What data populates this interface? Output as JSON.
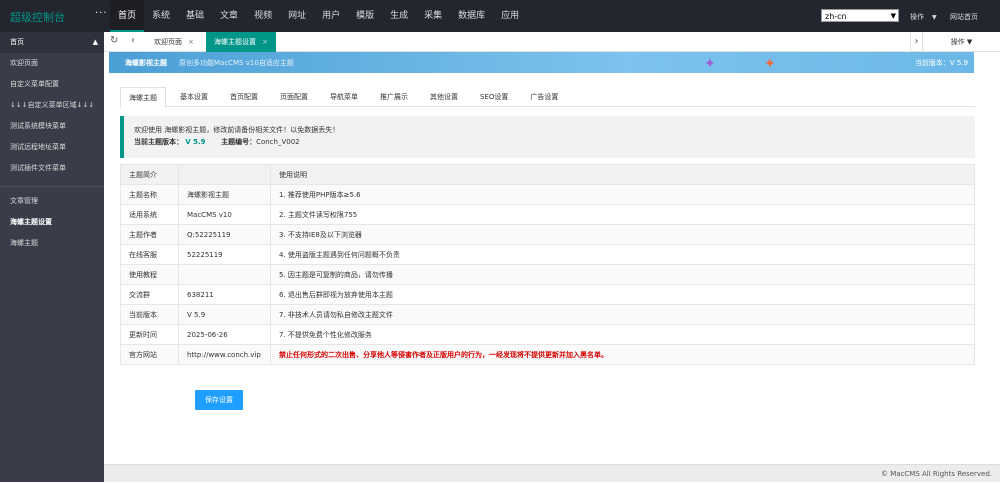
{
  "topbar": {
    "logo": "超级控制台",
    "nav": [
      "首页",
      "系统",
      "基础",
      "文章",
      "视频",
      "网址",
      "用户",
      "模版",
      "生成",
      "采集",
      "数据库",
      "应用"
    ],
    "lang": "zh-cn",
    "operate": "操作",
    "site_home": "网站首页"
  },
  "sidebar": {
    "head": "首页",
    "group1": [
      "欢迎页面",
      "自定义菜单配置",
      "↓↓↓自定义菜单区域↓↓↓",
      "测试系统模块菜单",
      "测试远程地址菜单",
      "测试插件文件菜单"
    ],
    "group2": [
      "文章管理",
      "海螺主题设置",
      "海螺主题"
    ]
  },
  "tabs": {
    "welcome": "欢迎页面",
    "theme": "海螺主题设置",
    "operate": "操作"
  },
  "banner": {
    "title": "海螺影视主题",
    "subtitle": "原创多功能MacCMS v10自适应主题",
    "version": "当前版本：V 5.9"
  },
  "content_tabs": [
    "海螺主题",
    "基本设置",
    "首页配置",
    "页面配置",
    "导航菜单",
    "推广展示",
    "其他设置",
    "SEO设置",
    "广告设置"
  ],
  "notice": {
    "line1": "欢迎使用 海螺影视主题，修改前请备份相关文件！以免数据丢失！",
    "version_label": "当前主题版本：",
    "version_value": "V 5.9",
    "id_label": "主题编号：",
    "id_value": "Conch_V002"
  },
  "table": {
    "header": [
      "主题简介",
      "",
      "使用说明"
    ],
    "rows": [
      [
        "主题名称",
        "海螺影视主题",
        "1. 推荐使用PHP版本≥5.6"
      ],
      [
        "适用系统",
        "MacCMS v10",
        "2. 主题文件读写权限755"
      ],
      [
        "主题作者",
        "Q:52225119",
        "3. 不支持IE8及以下浏览器"
      ],
      [
        "在线客服",
        "52225119",
        "4. 使用盗版主题遇到任何问题概不负责"
      ],
      [
        "使用教程",
        "",
        "5. 因主题是可复制的商品，请勿传播"
      ],
      [
        "交流群",
        "638211",
        "6. 退出售后群即视为放弃使用本主题"
      ],
      [
        "当前版本",
        "V 5.9",
        "7. 非技术人员请勿私自修改主题文件"
      ],
      [
        "更新时间",
        "2025-06-26",
        "7. 不提供免费个性化修改服务"
      ],
      [
        "官方网站",
        "http://www.conch.vip",
        "禁止任何形式的二次出售、分享他人等侵害作者及正版用户的行为，一经发现将不提供更新并加入黑名单。"
      ]
    ]
  },
  "save_label": "保存设置",
  "footer": "© MacCMS All Rights Reserved."
}
